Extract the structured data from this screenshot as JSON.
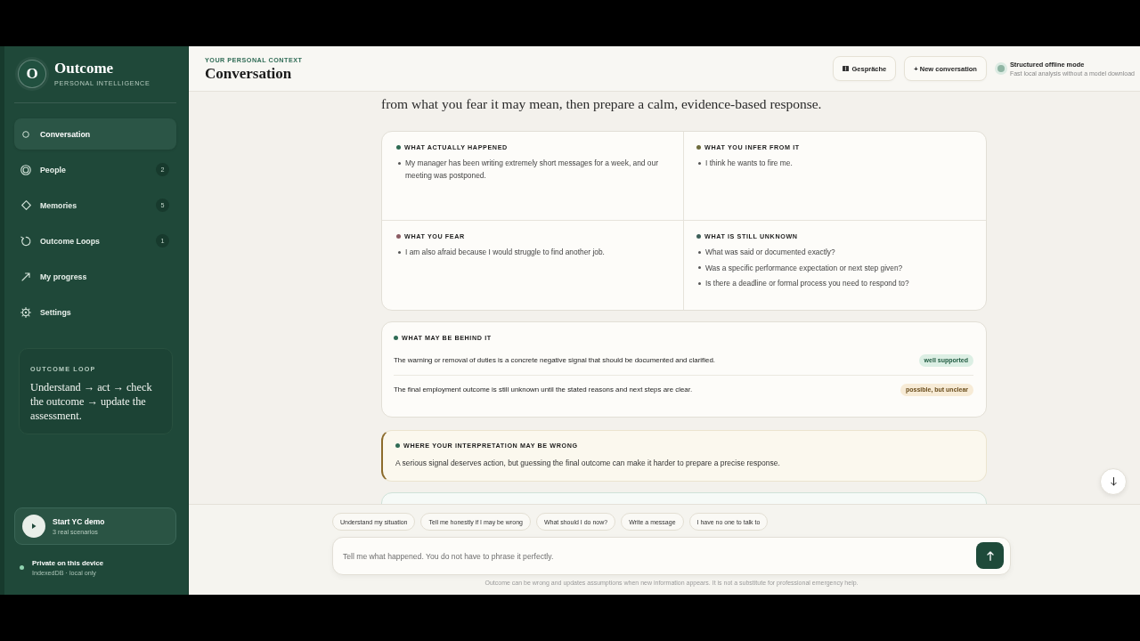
{
  "sidebar": {
    "brand": {
      "initial": "O",
      "name": "Outcome",
      "tagline": "PERSONAL INTELLIGENCE"
    },
    "nav": [
      {
        "label": "Conversation",
        "selected": true
      },
      {
        "label": "People",
        "count": "2",
        "selected": false
      },
      {
        "label": "Memories",
        "count": "5",
        "selected": false
      },
      {
        "label": "Outcome Loops",
        "count": "1",
        "selected": false
      },
      {
        "label": "My progress",
        "selected": false
      },
      {
        "label": "Settings",
        "selected": false
      }
    ],
    "loop_card": {
      "title": "OUTCOME LOOP",
      "text": "Understand → act → check the outcome → update the assessment."
    },
    "demo": {
      "title": "Start YC demo",
      "subtitle": "3 real scenarios"
    },
    "privacy": {
      "title": "Private on this device",
      "subtitle": "IndexedDB · local only"
    }
  },
  "header": {
    "eyebrow": "YOUR PERSONAL CONTEXT",
    "title": "Conversation",
    "buttons": [
      {
        "label": "Gespräche"
      },
      {
        "label": "+ New conversation"
      }
    ],
    "mode": {
      "title": "Structured offline mode",
      "subtitle": "Fast local analysis without a model download"
    }
  },
  "conversation": {
    "intro_tail": "from what you fear it may mean, then prepare a calm, evidence-based response.",
    "analysis": [
      {
        "title": "WHAT ACTUALLY HAPPENED",
        "color": "#2e6a52",
        "items": [
          "My manager has been writing extremely short messages for a week, and our meeting was postponed."
        ]
      },
      {
        "title": "WHAT YOU INFER FROM IT",
        "color": "#6d6b3c",
        "items": [
          "I think he wants to fire me."
        ]
      },
      {
        "title": "WHAT YOU FEAR",
        "color": "#8b5c63",
        "items": [
          "I am also afraid because I would struggle to find another job."
        ]
      },
      {
        "title": "WHAT IS STILL UNKNOWN",
        "color": "#3d5f59",
        "items": [
          "What was said or documented exactly?",
          "Was a specific performance expectation or next step given?",
          "Is there a deadline or formal process you need to respond to?"
        ]
      }
    ],
    "behind": {
      "title": "WHAT MAY BE BEHIND IT",
      "rows": [
        {
          "text": "The warning or removal of duties is a concrete negative signal that should be documented and clarified.",
          "badge": "well supported",
          "kind": "supported"
        },
        {
          "text": "The final employment outcome is still unknown until the stated reasons and next steps are clear.",
          "badge": "possible, but unclear",
          "kind": "uncertain"
        }
      ]
    },
    "caution": {
      "title": "WHERE YOUR INTERPRETATION MAY BE WRONG",
      "text": "A serious signal deserves action, but guessing the final outcome can make it harder to prepare a precise response."
    }
  },
  "composer": {
    "suggestions": [
      "Understand my situation",
      "Tell me honestly if I may be wrong",
      "What should I do now?",
      "Write a message",
      "I have no one to talk to"
    ],
    "input": {
      "placeholder": "Tell me what happened. You do not have to phrase it perfectly."
    },
    "disclaimer": "Outcome can be wrong and updates assumptions when new information appears. It is not a substitute for professional emergency help."
  }
}
